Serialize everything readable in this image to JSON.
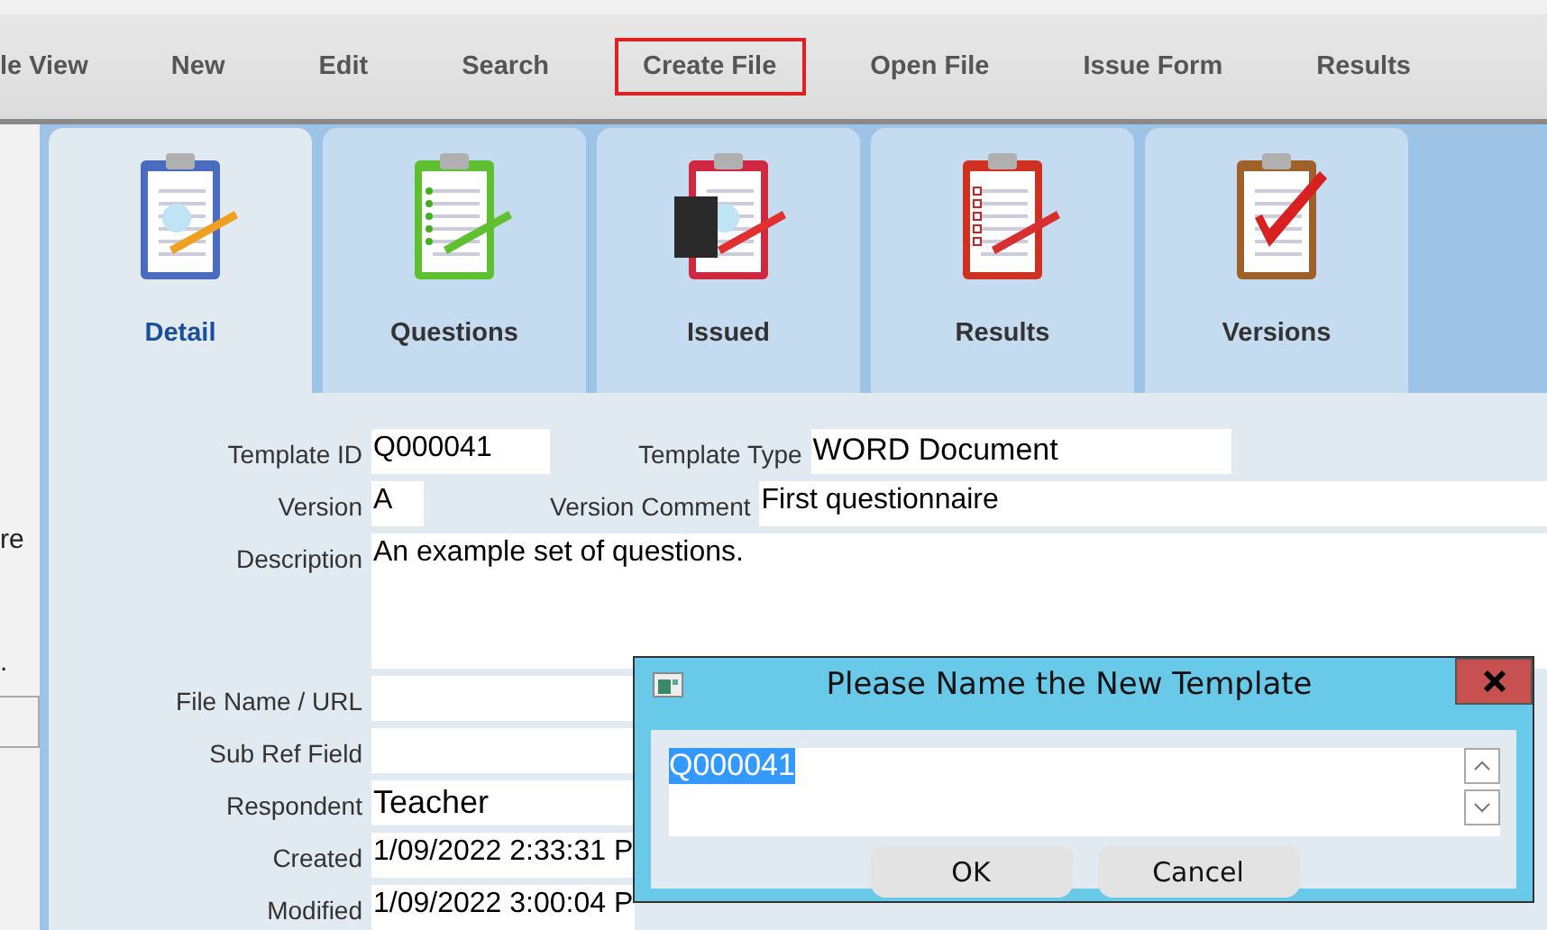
{
  "toolbar": [
    {
      "label": "le View",
      "highlighted": false
    },
    {
      "label": "New",
      "highlighted": false
    },
    {
      "label": "Edit",
      "highlighted": false
    },
    {
      "label": "Search",
      "highlighted": false
    },
    {
      "label": "Create File",
      "highlighted": true
    },
    {
      "label": "Open File",
      "highlighted": false
    },
    {
      "label": "Issue Form",
      "highlighted": false
    },
    {
      "label": "Results",
      "highlighted": false
    }
  ],
  "side_panel": {
    "texts": [
      "re",
      "."
    ]
  },
  "tabs": [
    {
      "label": "Detail",
      "kind": "detail",
      "selected": true
    },
    {
      "label": "Questions",
      "kind": "questions",
      "selected": false
    },
    {
      "label": "Issued",
      "kind": "issued",
      "selected": false
    },
    {
      "label": "Results",
      "kind": "results",
      "selected": false
    },
    {
      "label": "Versions",
      "kind": "versions",
      "selected": false
    }
  ],
  "form": {
    "rows": [
      {
        "label": "Template ID",
        "value": "Q000041",
        "kind": "short",
        "side": {
          "label": "Template Type",
          "value": "WORD Document",
          "kind": "medium"
        }
      },
      {
        "label": "Version",
        "value": "A",
        "kind": "tiny",
        "side": {
          "label": "Version Comment",
          "value": "First questionnaire",
          "kind": "wide"
        }
      },
      {
        "label": "Description",
        "value": "An example set of questions.",
        "kind": "area"
      },
      {
        "label": "File Name / URL",
        "kind": "line"
      },
      {
        "label": "Sub Ref Field",
        "kind": "line"
      },
      {
        "label": "Respondent",
        "value": "Teacher",
        "kind": "line"
      },
      {
        "label": "Created",
        "value": "1/09/2022 2:33:31 P",
        "kind": "line"
      },
      {
        "label": "Modified",
        "value": "1/09/2022 3:00:04 P",
        "kind": "line"
      }
    ]
  },
  "dialog": {
    "title": "Please Name the New Template",
    "value": "Q000041",
    "selected": true,
    "buttons": [
      {
        "label": "OK"
      },
      {
        "label": "Cancel"
      }
    ]
  }
}
